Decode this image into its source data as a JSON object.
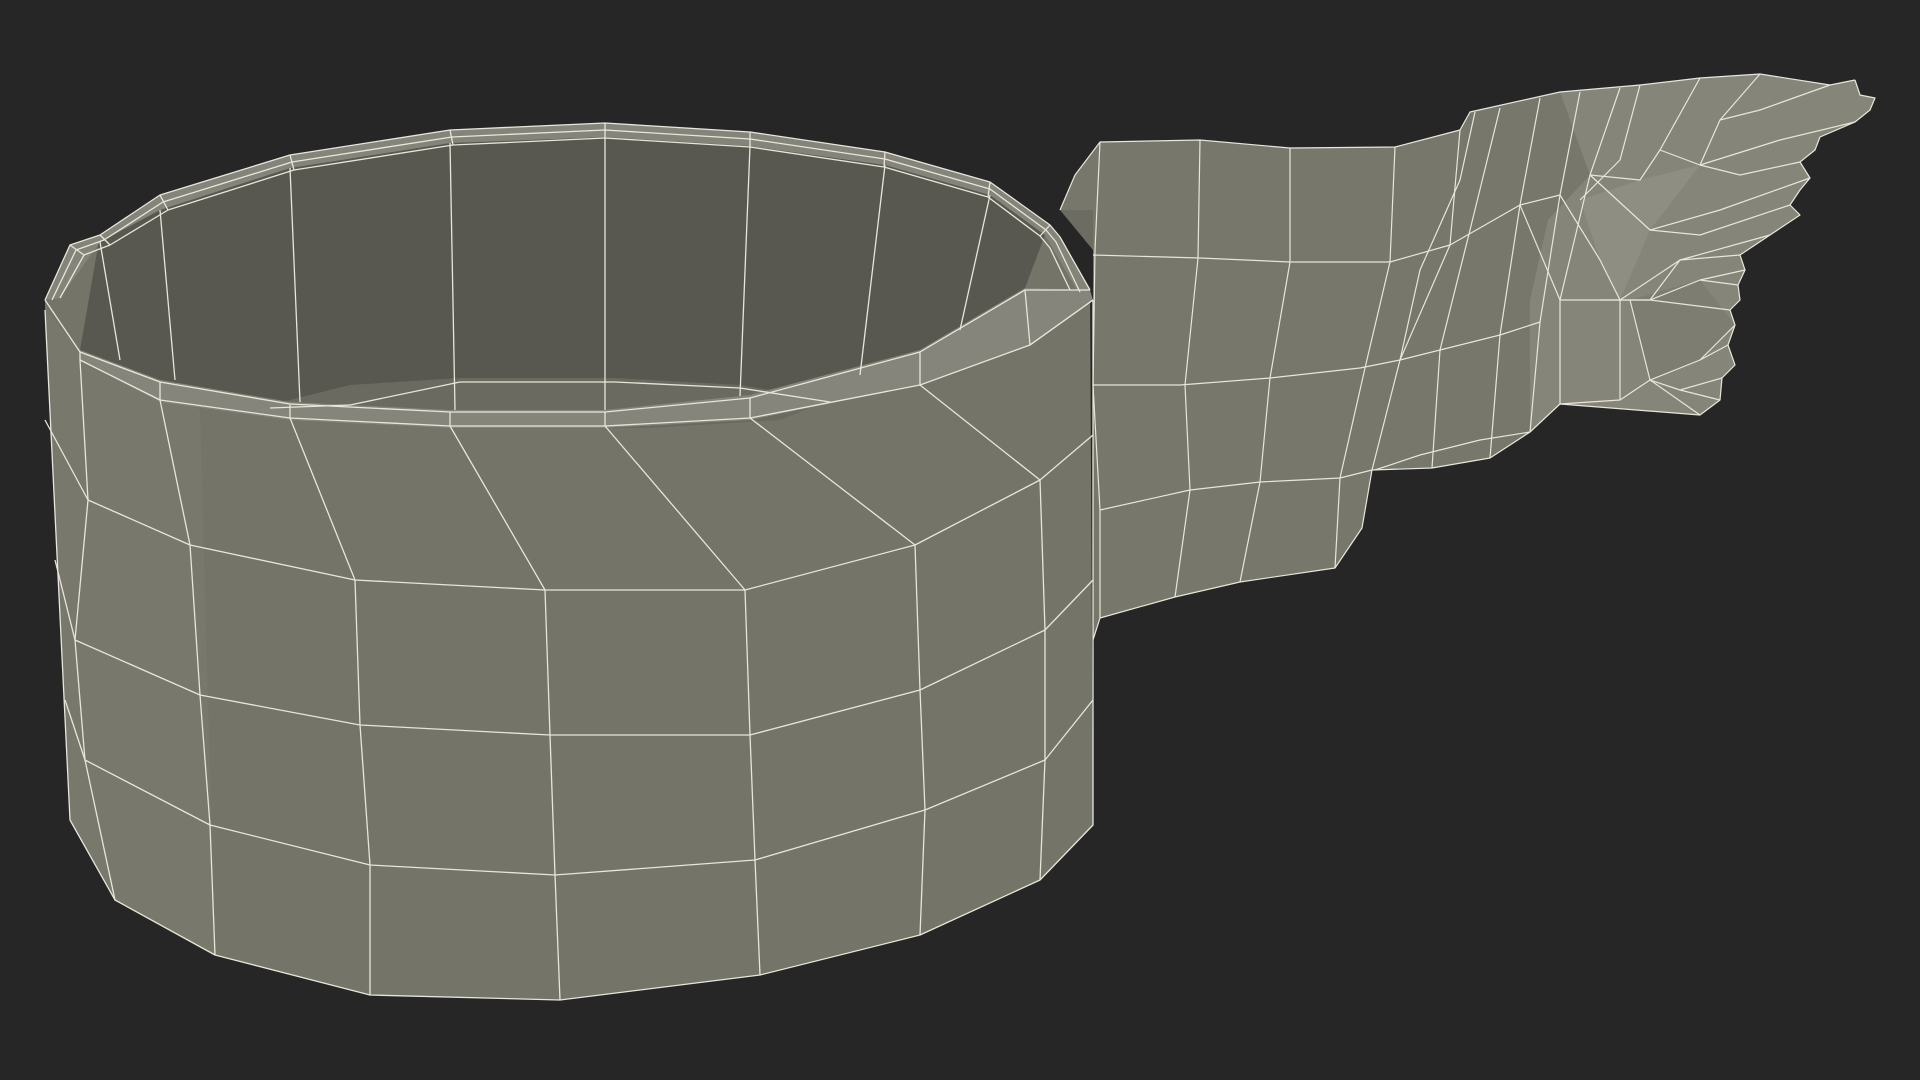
{
  "scene": {
    "subject": "wireframe-3d-mesh",
    "colors": {
      "background": "#262626",
      "outer_face": "#747469",
      "outer_face_light": "#7c7c71",
      "inner_wall": "#5a5a52",
      "inner_floor": "#6a6a61",
      "rim": "#8a8a80",
      "handle_face": "#77776c",
      "handle_end": "#86867c",
      "wire": "#e8e6d8"
    }
  }
}
